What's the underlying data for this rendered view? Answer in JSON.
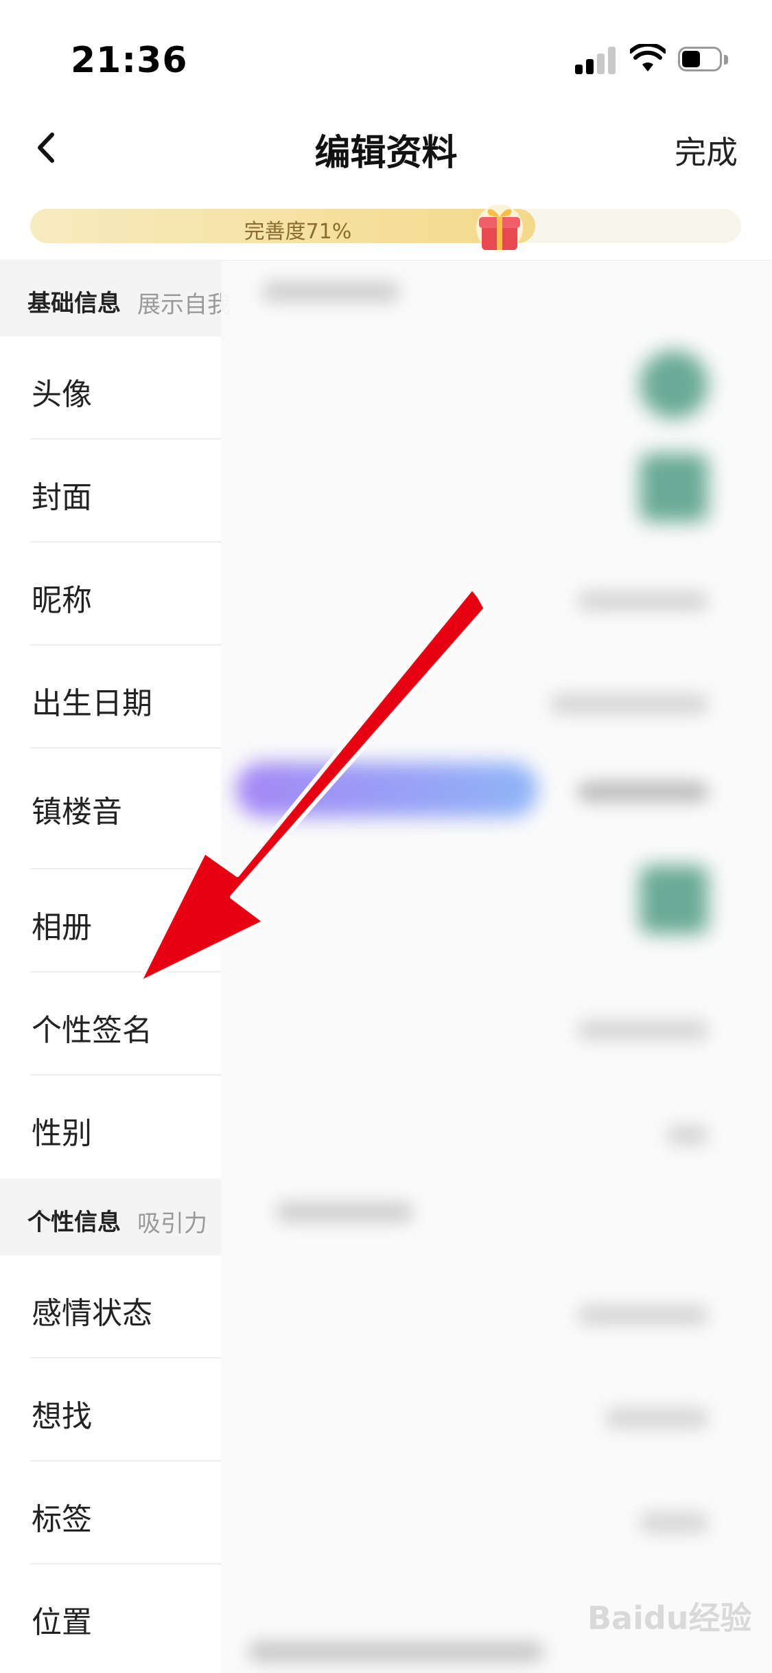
{
  "status_bar": {
    "time": "21:36"
  },
  "nav": {
    "title": "编辑资料",
    "done": "完成"
  },
  "progress": {
    "label": "完善度71%",
    "percent": 71
  },
  "sections": {
    "basic": {
      "title": "基础信息",
      "subtitle": "展示自我"
    },
    "personal": {
      "title": "个性信息",
      "subtitle": "吸引力"
    }
  },
  "basic_items": [
    "头像",
    "封面",
    "昵称",
    "出生日期",
    "镇楼音",
    "相册",
    "个性签名",
    "性别"
  ],
  "personal_items": [
    "感情状态",
    "想找",
    "标签",
    "位置"
  ],
  "watermark": "Baidu经验",
  "colors": {
    "accent": "#f4d98a",
    "arrow": "#e60012",
    "avatar_placeholder": "#6aaa96"
  }
}
